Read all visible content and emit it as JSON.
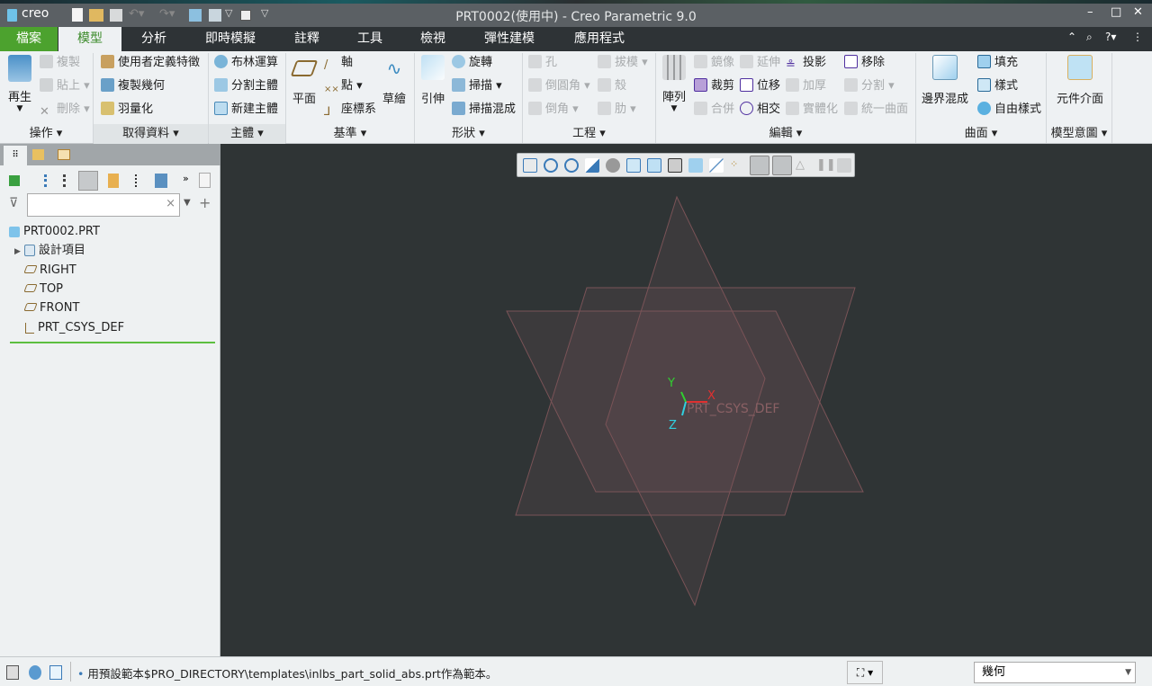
{
  "app": {
    "logo": "creo",
    "title": "PRT0002(使用中) - Creo Parametric 9.0"
  },
  "tabs": [
    "檔案",
    "模型",
    "分析",
    "即時模擬",
    "註釋",
    "工具",
    "檢視",
    "彈性建模",
    "應用程式"
  ],
  "ribbon": {
    "operations": {
      "label": "操作",
      "regenerate": "再生",
      "copy": "複製",
      "paste": "貼上",
      "delete": "刪除"
    },
    "get_data": {
      "label": "取得資料",
      "udf": "使用者定義特徵",
      "copy_geom": "複製幾何",
      "shrinkwrap": "羽量化"
    },
    "body": {
      "label": "主體",
      "boolean": "布林運算",
      "split_body": "分割主體",
      "new_body": "新建主體"
    },
    "datum": {
      "label": "基準",
      "plane": "平面",
      "axis": "軸",
      "point": "點",
      "csys": "座標系",
      "sketch": "草繪"
    },
    "shapes": {
      "label": "形狀",
      "extrude": "引伸",
      "revolve": "旋轉",
      "sweep": "掃描",
      "swept_blend": "掃描混成"
    },
    "engineering": {
      "label": "工程",
      "hole": "孔",
      "round": "倒圓角",
      "chamfer": "倒角",
      "draft": "拔模",
      "shell": "殼",
      "rib": "肋"
    },
    "editing": {
      "label": "編輯",
      "pattern": "陣列",
      "mirror": "鏡像",
      "trim": "裁剪",
      "merge": "合併",
      "extend": "延伸",
      "offset": "位移",
      "intersect": "相交",
      "project": "投影",
      "thicken": "加厚",
      "solidify": "實體化",
      "remove": "移除",
      "split": "分割",
      "unify": "統一曲面"
    },
    "surfaces": {
      "label": "曲面",
      "boundary_blend": "邊界混成",
      "fill": "填充",
      "style": "樣式",
      "freestyle": "自由樣式"
    },
    "model_intent": {
      "label": "模型意圖",
      "component_interface": "元件介面"
    }
  },
  "tree": {
    "filter_value": "",
    "items": [
      "PRT0002.PRT",
      "設計項目",
      "RIGHT",
      "TOP",
      "FRONT",
      "PRT_CSYS_DEF"
    ]
  },
  "viewport": {
    "csys_label": "PRT_CSYS_DEF",
    "axis_x": "X",
    "axis_y": "Y",
    "axis_z": "Z"
  },
  "status": {
    "message": "用預設範本$PRO_DIRECTORY\\templates\\inlbs_part_solid_abs.prt作為範本。",
    "filter": "幾何"
  }
}
